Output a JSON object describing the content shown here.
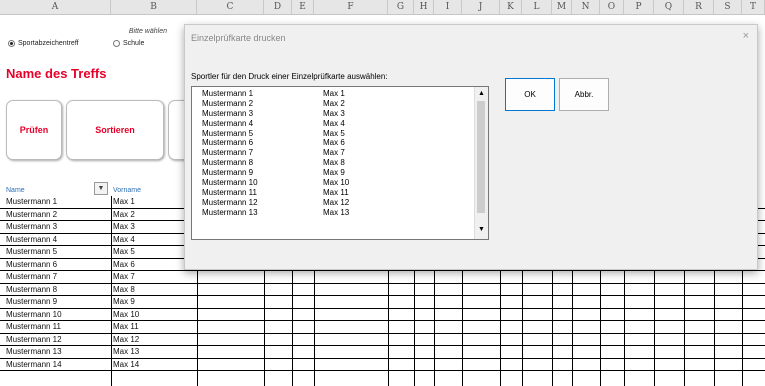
{
  "columns": [
    "A",
    "B",
    "C",
    "D",
    "E",
    "F",
    "G",
    "H",
    "I",
    "J",
    "K",
    "L",
    "M",
    "N",
    "O",
    "P",
    "Q",
    "R",
    "S",
    "T"
  ],
  "sheet": {
    "hint": "Bitte wählen",
    "radio_1": "Sportabzeichentreff",
    "radio_2": "Schule",
    "treff_title": "Name des Treffs",
    "btn_pruefen": "Prüfen",
    "btn_sortieren": "Sortieren",
    "header_name": "Name",
    "header_vorname": "Vorname",
    "rows": [
      {
        "name": "Mustermann 1",
        "vorname": "Max 1"
      },
      {
        "name": "Mustermann 2",
        "vorname": "Max 2"
      },
      {
        "name": "Mustermann 3",
        "vorname": "Max 3"
      },
      {
        "name": "Mustermann 4",
        "vorname": "Max 4"
      },
      {
        "name": "Mustermann 5",
        "vorname": "Max 5"
      },
      {
        "name": "Mustermann 6",
        "vorname": "Max 6"
      },
      {
        "name": "Mustermann 7",
        "vorname": "Max 7"
      },
      {
        "name": "Mustermann 8",
        "vorname": "Max 8"
      },
      {
        "name": "Mustermann 9",
        "vorname": "Max 9"
      },
      {
        "name": "Mustermann 10",
        "vorname": "Max 10"
      },
      {
        "name": "Mustermann 11",
        "vorname": "Max 11"
      },
      {
        "name": "Mustermann 12",
        "vorname": "Max 12"
      },
      {
        "name": "Mustermann 13",
        "vorname": "Max 13"
      },
      {
        "name": "Mustermann 14",
        "vorname": "Max 14"
      }
    ]
  },
  "dialog": {
    "title": "Einzelprüfkarte drucken",
    "close": "×",
    "prompt": "Sportler für den Druck einer Einzelprüfkarte auswählen:",
    "ok_label": "OK",
    "cancel_label": "Abbr.",
    "items": [
      {
        "name": "Mustermann 1",
        "vorname": "Max 1"
      },
      {
        "name": "Mustermann 2",
        "vorname": "Max 2"
      },
      {
        "name": "Mustermann 3",
        "vorname": "Max 3"
      },
      {
        "name": "Mustermann 4",
        "vorname": "Max 4"
      },
      {
        "name": "Mustermann 5",
        "vorname": "Max 5"
      },
      {
        "name": "Mustermann 6",
        "vorname": "Max 6"
      },
      {
        "name": "Mustermann 7",
        "vorname": "Max 7"
      },
      {
        "name": "Mustermann 8",
        "vorname": "Max 8"
      },
      {
        "name": "Mustermann 9",
        "vorname": "Max 9"
      },
      {
        "name": "Mustermann 10",
        "vorname": "Max 10"
      },
      {
        "name": "Mustermann 11",
        "vorname": "Max 11"
      },
      {
        "name": "Mustermann 12",
        "vorname": "Max 12"
      },
      {
        "name": "Mustermann 13",
        "vorname": "Max 13"
      }
    ]
  },
  "colors": {
    "accent_red": "#e8002a",
    "header_blue": "#2f6fb5",
    "focus_blue": "#0078d7"
  },
  "icons": {
    "scroll_up": "▲",
    "scroll_down": "▼",
    "dropdown": "▼"
  }
}
